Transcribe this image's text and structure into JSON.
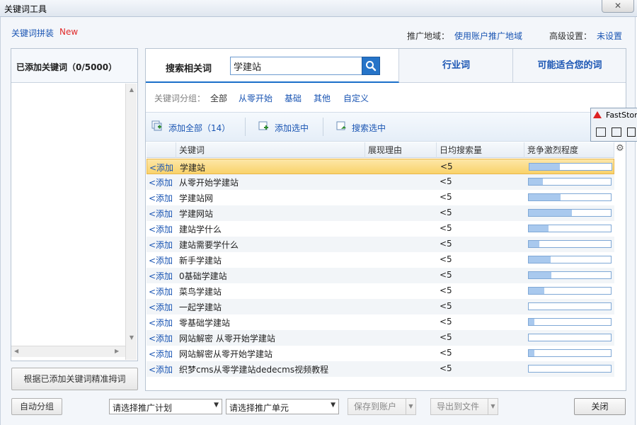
{
  "window": {
    "title": "关键词工具",
    "close": "✕"
  },
  "header": {
    "tab_link": "关键词拼装",
    "new_badge": "New",
    "region_label": "推广地域：",
    "region_value": "使用账户推广地域",
    "advanced_label": "高级设置：",
    "advanced_value": "未设置"
  },
  "left": {
    "title": "已添加关键词（0/5000）",
    "precise_button": "根据已添加关键词精准拇词"
  },
  "tabs": {
    "search_label": "搜索相关词",
    "search_value": "学建站",
    "industry": "行业词",
    "suitable": "可能适合您的词"
  },
  "groups": {
    "label": "关键词分组：",
    "items": [
      "全部",
      "从零开始",
      "基础",
      "其他",
      "自定义"
    ]
  },
  "toolbar": {
    "add_all": "添加全部（14）",
    "add_selected": "添加选中",
    "search_selected": "搜索选中"
  },
  "table": {
    "headers": [
      "关键词",
      "展现理由",
      "日均搜索量",
      "竞争激烈程度"
    ],
    "add_text": "<添加",
    "rows": [
      {
        "keyword": "学建站",
        "volume": "<5",
        "competition": 0.37
      },
      {
        "keyword": "从零开始学建站",
        "volume": "<5",
        "competition": 0.17
      },
      {
        "keyword": "学建站网",
        "volume": "<5",
        "competition": 0.39
      },
      {
        "keyword": "学建网站",
        "volume": "<5",
        "competition": 0.53
      },
      {
        "keyword": "建站学什么",
        "volume": "<5",
        "competition": 0.24
      },
      {
        "keyword": "建站需要学什么",
        "volume": "<5",
        "competition": 0.13
      },
      {
        "keyword": "新手学建站",
        "volume": "<5",
        "competition": 0.27
      },
      {
        "keyword": "0基础学建站",
        "volume": "<5",
        "competition": 0.28
      },
      {
        "keyword": "菜鸟学建站",
        "volume": "<5",
        "competition": 0.19
      },
      {
        "keyword": "一起学建站",
        "volume": "<5",
        "competition": 0.0
      },
      {
        "keyword": "零基础学建站",
        "volume": "<5",
        "competition": 0.07
      },
      {
        "keyword": "网站解密 从零开始学建站",
        "volume": "<5",
        "competition": 0.0
      },
      {
        "keyword": "网站解密从零开始学建站",
        "volume": "<5",
        "competition": 0.07
      },
      {
        "keyword": "织梦cms从零学建站dedecms视频教程",
        "volume": "<5",
        "competition": 0.0
      }
    ]
  },
  "footer": {
    "auto_group": "自动分组",
    "plan_select": "请选择推广计划",
    "unit_select": "请选择推广单元",
    "save_account": "保存到账户",
    "export_file": "导出到文件",
    "close": "关闭"
  },
  "overlay": {
    "title": "FastSton"
  },
  "colors": {
    "link": "#1a55b3",
    "accent": "#2674c8",
    "new_badge": "#e02a2a",
    "selected_row": "#f9d26a",
    "bar_fill": "#a9c9ee"
  }
}
